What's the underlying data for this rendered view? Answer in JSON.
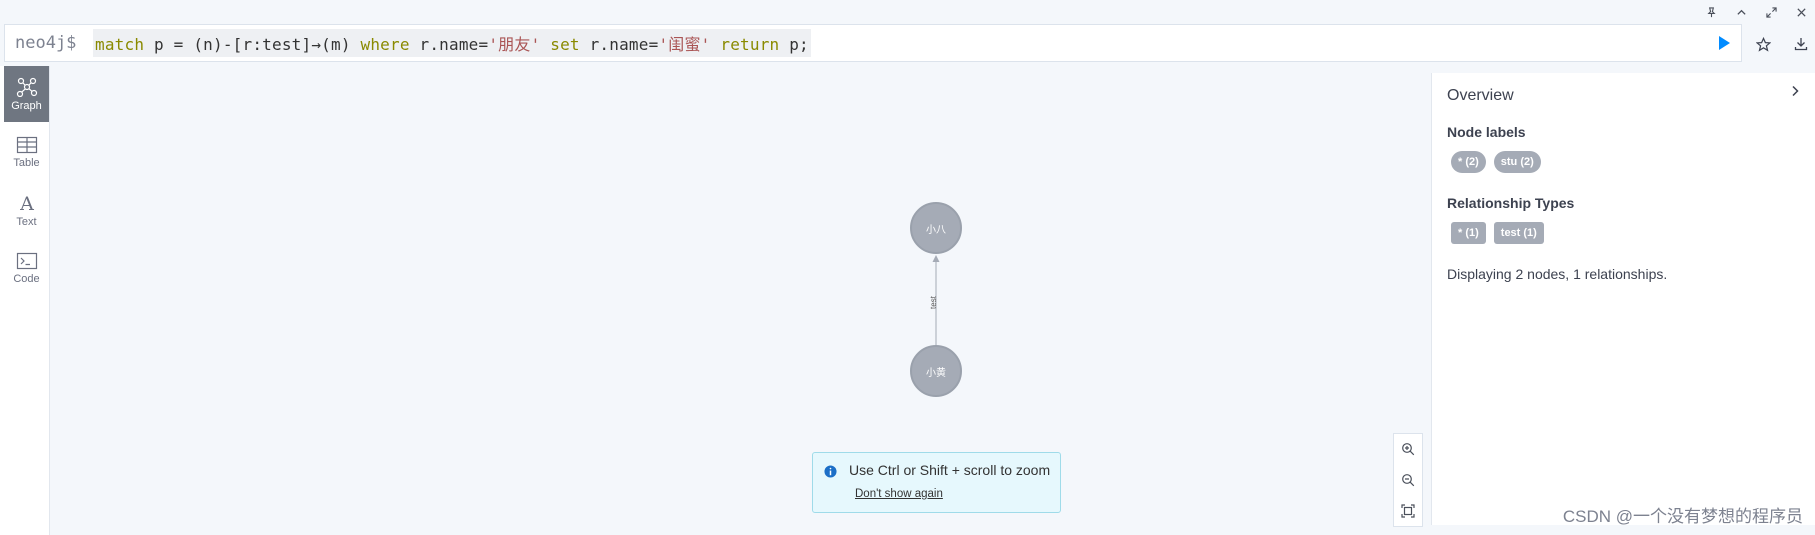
{
  "window_controls": [
    "pin-icon",
    "chevron-up-icon",
    "expand-icon",
    "close-icon"
  ],
  "editor": {
    "prompt": "neo4j$",
    "query_tokens": [
      {
        "t": "match",
        "c": "kw"
      },
      {
        "t": " p = (n)-[r:test]→(m) ",
        "c": "plain"
      },
      {
        "t": "where",
        "c": "kw"
      },
      {
        "t": " r.name=",
        "c": "plain"
      },
      {
        "t": "'朋友'",
        "c": "str"
      },
      {
        "t": " ",
        "c": "plain"
      },
      {
        "t": "set",
        "c": "kw"
      },
      {
        "t": " r.name=",
        "c": "plain"
      },
      {
        "t": "'闺蜜'",
        "c": "str"
      },
      {
        "t": " ",
        "c": "plain"
      },
      {
        "t": "return",
        "c": "kw"
      },
      {
        "t": " p;",
        "c": "plain"
      }
    ]
  },
  "sidebar": {
    "items": [
      {
        "label": "Graph",
        "icon": "graph-icon",
        "active": true
      },
      {
        "label": "Table",
        "icon": "table-icon",
        "active": false
      },
      {
        "label": "Text",
        "icon": "text-icon",
        "active": false
      },
      {
        "label": "Code",
        "icon": "code-icon",
        "active": false
      }
    ]
  },
  "graph": {
    "nodes": [
      {
        "id": "n_top",
        "label": "小八"
      },
      {
        "id": "n_bottom",
        "label": "小黄"
      }
    ],
    "relationship": {
      "label": "test"
    }
  },
  "toast": {
    "message": "Use Ctrl or Shift + scroll to zoom",
    "dismiss": "Don't show again"
  },
  "overview": {
    "title": "Overview",
    "node_labels_heading": "Node labels",
    "node_labels": [
      "* (2)",
      "stu (2)"
    ],
    "rel_types_heading": "Relationship Types",
    "rel_types": [
      "* (1)",
      "test (1)"
    ],
    "summary": "Displaying 2 nodes, 1 relationships."
  },
  "watermark": "CSDN @一个没有梦想的程序员",
  "colors": {
    "node_fill": "#a5abb6",
    "run_button": "#018bff",
    "active_tab": "#6f7681"
  }
}
